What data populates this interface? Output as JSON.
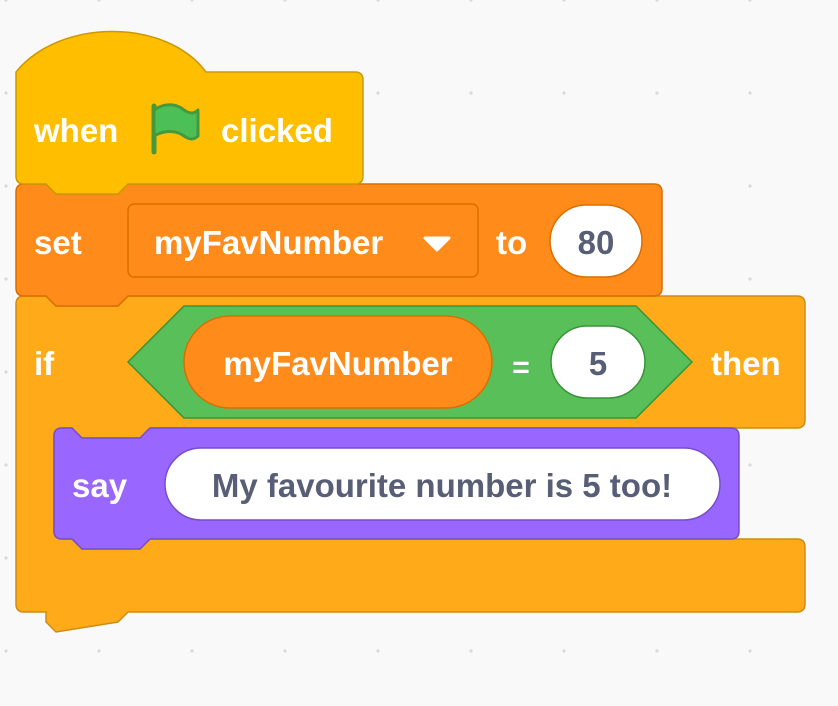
{
  "colors": {
    "background": "#f9f9f9",
    "grid_dot": "#d6d9de",
    "events_fill": "#ffbf00",
    "events_stroke": "#cc9900",
    "variables_fill": "#ff8c1a",
    "variables_stroke": "#db6e00",
    "control_fill": "#ffab19",
    "control_stroke": "#cf8b17",
    "operators_fill": "#59c059",
    "operators_stroke": "#389438",
    "looks_fill": "#9966ff",
    "looks_stroke": "#774dcb",
    "flag_green": "#4cbf56",
    "flag_stroke": "#45993d",
    "field_text": "#575e75"
  },
  "script": {
    "hat": {
      "word_when": "when",
      "icon": "green-flag-icon",
      "word_clicked": "clicked"
    },
    "set_variable": {
      "word_set": "set",
      "variable_name": "myFavNumber",
      "dropdown_icon": "caret-down-icon",
      "word_to": "to",
      "value": "80"
    },
    "if_block": {
      "word_if": "if",
      "condition": {
        "left_reporter": "myFavNumber",
        "operator": "=",
        "right_value": "5"
      },
      "word_then": "then",
      "body": {
        "say": {
          "word_say": "say",
          "message": "My favourite number is 5 too!"
        }
      }
    }
  }
}
